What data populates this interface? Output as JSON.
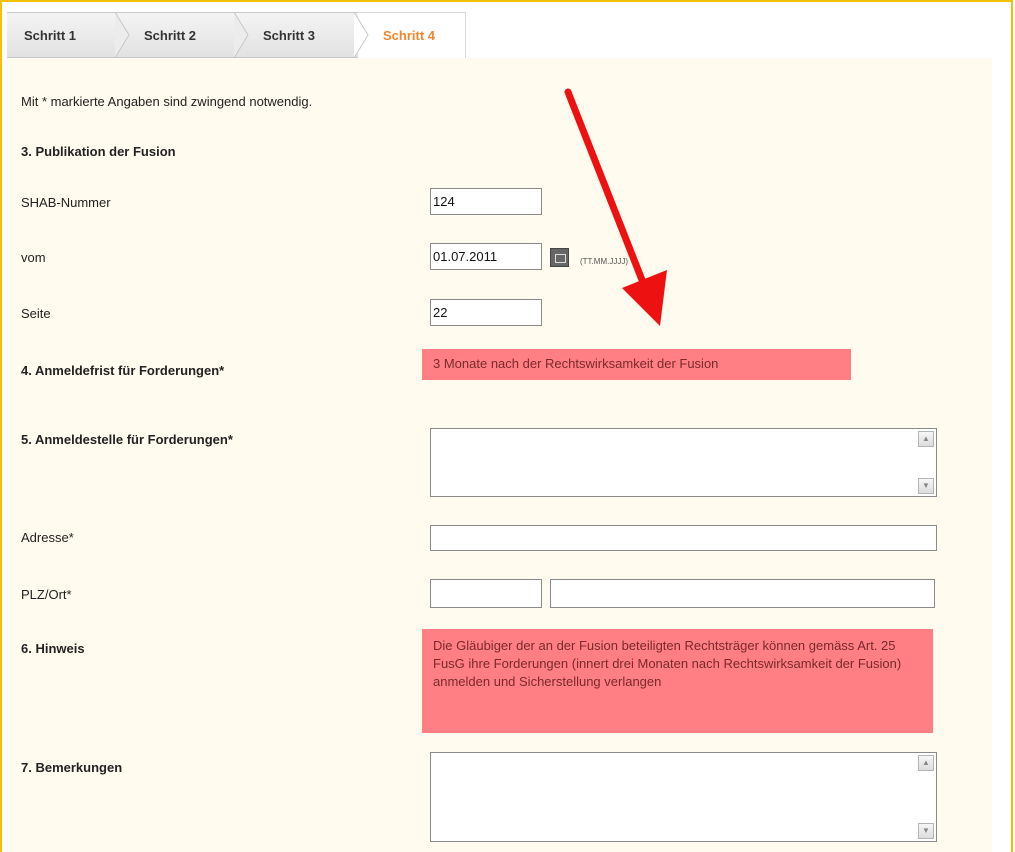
{
  "tabs": [
    {
      "label": "Schritt 1"
    },
    {
      "label": "Schritt 2"
    },
    {
      "label": "Schritt 3"
    },
    {
      "label": "Schritt 4"
    }
  ],
  "form": {
    "required_note": "Mit * markierte Angaben sind zwingend notwendig.",
    "section3_title": "3. Publikation der Fusion",
    "shab_label": "SHAB-Nummer",
    "shab_value": "124",
    "date_label": "vom",
    "date_value": "01.07.2011",
    "date_format": "(TT.MM.JJJJ)",
    "page_label": "Seite",
    "page_value": "22",
    "section4_title": "4. Anmeldefrist für Forderungen*",
    "section4_value": "3 Monate nach der Rechtswirksamkeit der Fusion",
    "section5_title": "5. Anmeldestelle für Forderungen*",
    "address_label": "Adresse*",
    "plz_label": "PLZ/Ort*",
    "section6_title": "6. Hinweis",
    "section6_text": "Die Gläubiger der an der Fusion beteiligten Rechtsträger können gemäss Art. 25 FusG ihre Forderungen (innert drei Monaten nach Rechtswirksamkeit der Fusion) anmelden und Sicherstellung verlangen",
    "section7_title": "7. Bemerkungen"
  },
  "colors": {
    "accent": "#f0872e",
    "highlight": "#ff7f84",
    "arrow": "#ee1111"
  }
}
